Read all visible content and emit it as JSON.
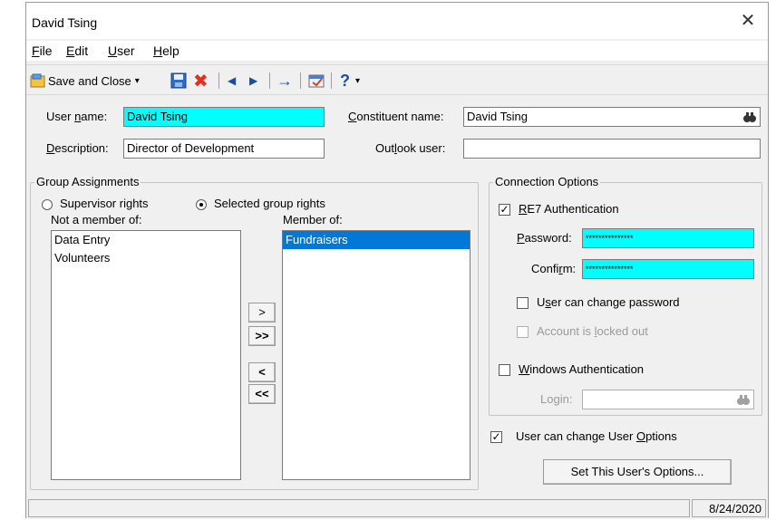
{
  "window": {
    "title": "David Tsing",
    "close_symbol": "✕"
  },
  "menu": [
    {
      "id": "file",
      "pre": "",
      "acc": "F",
      "post": "ile"
    },
    {
      "id": "edit",
      "pre": "",
      "acc": "E",
      "post": "dit"
    },
    {
      "id": "user",
      "pre": "",
      "acc": "U",
      "post": "ser"
    },
    {
      "id": "help",
      "pre": "",
      "acc": "H",
      "post": "elp"
    }
  ],
  "toolbar": {
    "save_close_label": "Save and Close",
    "dropdown_glyph": "▾",
    "prev_glyph": "◀",
    "next_glyph": "▶",
    "goto_glyph": "→",
    "help_glyph": "?",
    "delete_glyph": "✖"
  },
  "form": {
    "user_name": {
      "pre": "User ",
      "acc": "n",
      "post": "ame:",
      "value": "David Tsing"
    },
    "description": {
      "pre": "",
      "acc": "D",
      "post": "escription:",
      "value": "Director of Development"
    },
    "constituent_name": {
      "pre": "",
      "acc": "C",
      "post": "onstituent name:",
      "value": "David Tsing"
    },
    "outlook_user": {
      "pre": "Out",
      "acc": "l",
      "post": "ook user:",
      "value": ""
    }
  },
  "group_assignments": {
    "title": "Group Assignments",
    "supervisor_label": "Supervisor rights",
    "selected_label": "Selected group rights",
    "selected_rights": "selected",
    "not_member_label": "Not a member of:",
    "member_label": "Member of:",
    "not_member": [
      "Data Entry",
      "Volunteers"
    ],
    "member": [
      "Fundraisers"
    ],
    "move_right": ">",
    "move_all_right": ">>",
    "move_left": "<",
    "move_all_left": "<<"
  },
  "connection": {
    "title": "Connection Options",
    "re7_auth": {
      "pre": "",
      "acc": "R",
      "post": "E7 Authentication",
      "checked": true
    },
    "password": {
      "pre": "",
      "acc": "P",
      "post": "assword:",
      "value": "***************"
    },
    "confirm": {
      "pre": "Confi",
      "acc": "r",
      "post": "m:",
      "value": "***************"
    },
    "user_can_change_password": {
      "pre": "U",
      "acc": "s",
      "post": "er can change password",
      "checked": false
    },
    "account_locked": {
      "pre": "Account is ",
      "acc": "l",
      "post": "ocked out",
      "checked": false
    },
    "windows_auth": {
      "pre": "",
      "acc": "W",
      "post": "indows Authentication",
      "checked": false
    },
    "login": {
      "pre": "Lo",
      "acc": "g",
      "post": "in:",
      "value": ""
    }
  },
  "user_options": {
    "checkbox": {
      "pre": "User can change User ",
      "acc": "O",
      "post": "ptions",
      "checked": true
    },
    "button_label": "Set This User's Options..."
  },
  "status": {
    "date": "8/24/2020"
  },
  "colors": {
    "highlight": "#00ffff",
    "selection": "#0078d7"
  }
}
